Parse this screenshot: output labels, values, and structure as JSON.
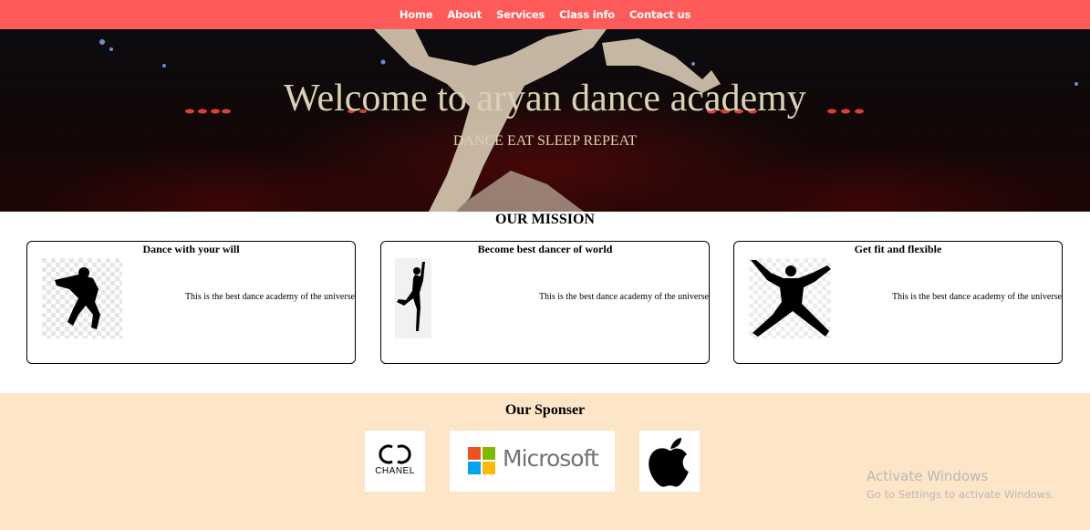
{
  "nav": {
    "items": [
      {
        "label": "Home"
      },
      {
        "label": "About"
      },
      {
        "label": "Services"
      },
      {
        "label": "Class info"
      },
      {
        "label": "Contact us"
      }
    ]
  },
  "hero": {
    "title": "Welcome to aryan dance academy",
    "subtitle": "DANCE EAT SLEEP REPEAT"
  },
  "mission": {
    "heading": "OUR MISSION",
    "cards": [
      {
        "title": "Dance with your will",
        "text": "This is the best dance academy of the universe",
        "image": "hiphop-dancer-silhouette"
      },
      {
        "title": "Become best dancer of world",
        "text": "This is the best dance academy of the universe",
        "image": "ballet-dancer-silhouette"
      },
      {
        "title": "Get fit and flexible",
        "text": "This is the best dance academy of the universe",
        "image": "jumping-dancer-silhouette"
      }
    ]
  },
  "sponsors": {
    "heading": "Our Sponser",
    "logos": [
      {
        "name": "chanel-logo",
        "text": "CHANEL"
      },
      {
        "name": "microsoft-logo",
        "text": "Microsoft"
      },
      {
        "name": "apple-logo"
      }
    ]
  },
  "watermark": {
    "title": "Activate Windows",
    "subtitle": "Go to Settings to activate Windows."
  },
  "colors": {
    "navbar": "#ff5a5a",
    "sponsor_bg": "#fde5c8",
    "hero_text": "#d8d2b4"
  }
}
